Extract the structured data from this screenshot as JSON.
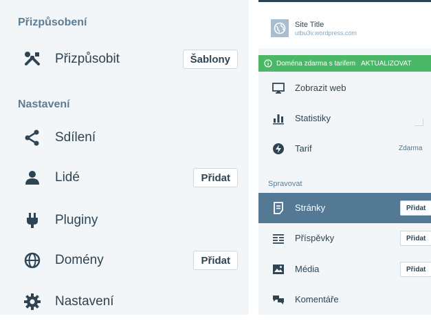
{
  "left_panel": {
    "section_customize": "Přizpůsobení",
    "customize_label": "Přizpůsobit",
    "customize_button": "Šablony",
    "section_settings": "Nastavení",
    "sharing_label": "Sdílení",
    "people_label": "Lidé",
    "people_button": "Přidat",
    "plugins_label": "Pluginy",
    "domains_label": "Domény",
    "domains_button": "Přidat",
    "settings_label": "Nastavení"
  },
  "right_panel": {
    "site_title": "Site Title",
    "site_url": "utbu3v.wordpress.com",
    "notice_text": "Doména zdarma s tarifem",
    "notice_cta": "AKTUALIZOVAT",
    "view_site": "Zobrazit web",
    "stats": "Statistiky",
    "plan": "Tarif",
    "plan_value": "Zdarma",
    "section_manage": "Spravovat",
    "pages": "Stránky",
    "pages_button": "Přidat",
    "posts": "Příspěvky",
    "posts_button": "Přidat",
    "media": "Média",
    "media_button": "Přidat",
    "comments": "Komentáře"
  },
  "icons": {
    "customize": "tools-icon",
    "sharing": "share-icon",
    "people": "person-icon",
    "plugins": "plug-icon",
    "domains": "globe-icon",
    "settings": "gear-icon",
    "view_site": "monitor-icon",
    "stats": "bar-chart-icon",
    "plan": "plan-icon",
    "pages": "page-icon",
    "posts": "posts-icon",
    "media": "image-icon",
    "comments": "comments-icon"
  },
  "colors": {
    "sidebar_bg": "#f3f6f8",
    "text": "#2e4453",
    "section": "#5c7c94",
    "selected_bg": "#537994",
    "notice_bg": "#4ab866"
  }
}
